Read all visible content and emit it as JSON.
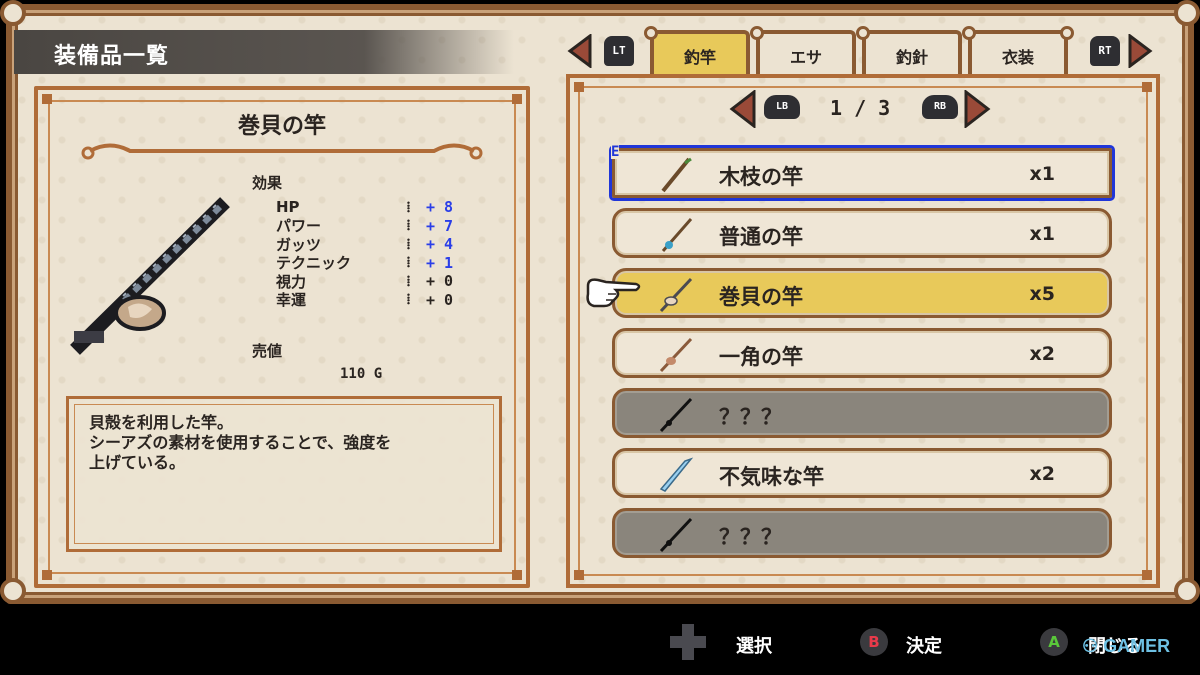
{
  "header": {
    "title": "装備品一覧"
  },
  "tabs": [
    {
      "label": "釣竿",
      "active": true
    },
    {
      "label": "エサ",
      "active": false
    },
    {
      "label": "釣針",
      "active": false
    },
    {
      "label": "衣装",
      "active": false
    }
  ],
  "shoulder_buttons": {
    "left": "LT",
    "right": "RT"
  },
  "detail": {
    "name": "巻貝の竿",
    "effect_heading": "効果",
    "stats": [
      {
        "name": "HP",
        "value": "+ 8"
      },
      {
        "name": "パワー",
        "value": "+ 7"
      },
      {
        "name": "ガッツ",
        "value": "+ 4"
      },
      {
        "name": "テクニック",
        "value": "+ 1"
      },
      {
        "name": "視力",
        "value": "+ 0"
      },
      {
        "name": "幸運",
        "value": "+ 0"
      }
    ],
    "stat_separator": "⁞",
    "sell_heading": "売値",
    "sell_price": "110 G",
    "description": "貝殻を利用した竿。\nシーアズの素材を使用することで、強度を\n上げている。"
  },
  "pager": {
    "left_button": "LB",
    "right_button": "RB",
    "indicator": "1 / 3"
  },
  "items": [
    {
      "name": "木枝の竿",
      "qty": "x1",
      "state": "equipped",
      "badge": "E",
      "icon": "branch-rod-icon"
    },
    {
      "name": "普通の竿",
      "qty": "x1",
      "state": "normal",
      "icon": "normal-rod-icon"
    },
    {
      "name": "巻貝の竿",
      "qty": "x5",
      "state": "selected",
      "icon": "shell-rod-icon"
    },
    {
      "name": "一角の竿",
      "qty": "x2",
      "state": "normal",
      "icon": "horn-rod-icon"
    },
    {
      "name": "？？？",
      "qty": "",
      "state": "locked",
      "icon": "unknown-rod-icon"
    },
    {
      "name": "不気味な竿",
      "qty": "x2",
      "state": "normal",
      "icon": "eerie-rod-icon"
    },
    {
      "name": "？？？",
      "qty": "",
      "state": "locked",
      "icon": "unknown-rod-icon"
    }
  ],
  "footer": {
    "select_label": "選択",
    "confirm_button": "B",
    "confirm_label": "決定",
    "close_button": "A",
    "close_label": "閉じる"
  },
  "watermark": "GAMER",
  "colors": {
    "accent_yellow": "#e8c95a",
    "frame_brown": "#8a5a32",
    "equip_blue": "#2036d8",
    "stat_blue": "#2a3ee8"
  }
}
